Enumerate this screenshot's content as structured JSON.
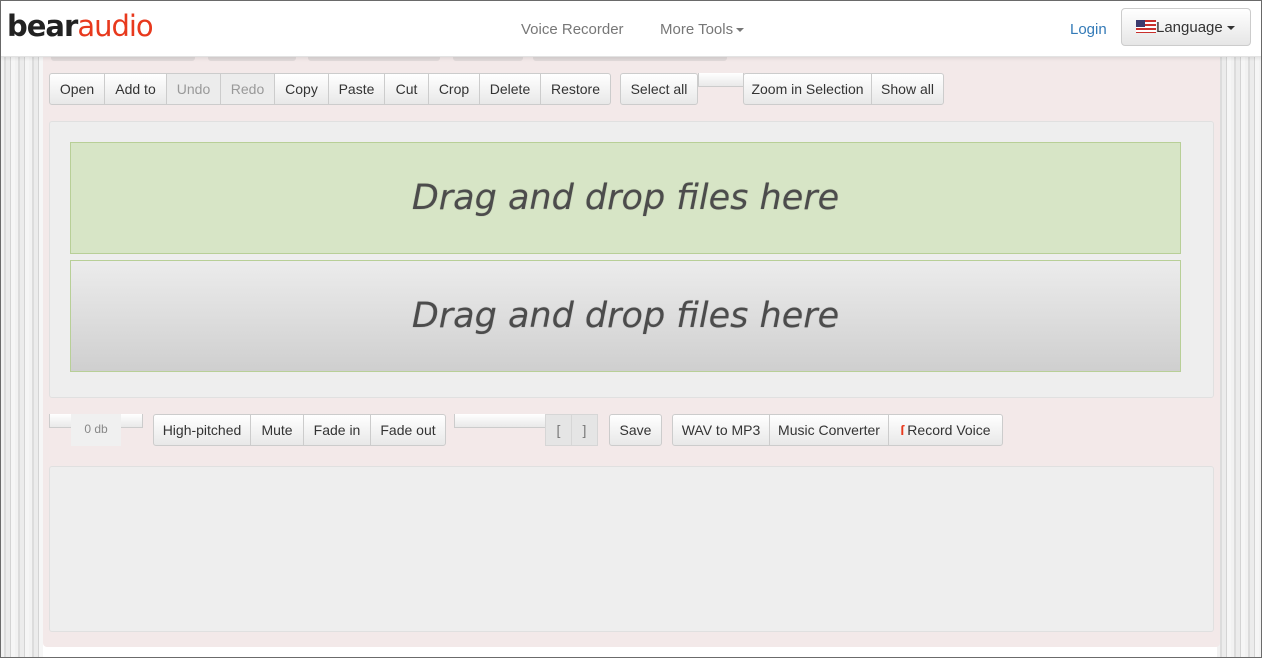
{
  "navbar": {
    "logo_part1": "bear",
    "logo_part2": "audio",
    "voice_recorder": "Voice Recorder",
    "more_tools": "More Tools",
    "login": "Login",
    "language": "Language"
  },
  "toolbar_top": {
    "open": "Open",
    "add_to": "Add to",
    "undo": "Undo",
    "redo": "Redo",
    "copy": "Copy",
    "paste": "Paste",
    "cut": "Cut",
    "crop": "Crop",
    "delete": "Delete",
    "restore": "Restore",
    "select_all": "Select all",
    "zoom_in_selection": "Zoom in Selection",
    "show_all": "Show all"
  },
  "dropzone": {
    "track1": "Drag and drop files here",
    "track2": "Drag and drop files here"
  },
  "toolbar_bottom": {
    "volume": "0 db",
    "high_pitched": "High-pitched",
    "mute": "Mute",
    "fade_in": "Fade in",
    "fade_out": "Fade out",
    "bracket_open": "[",
    "bracket_close": "]",
    "save": "Save",
    "wav_to_mp3": "WAV to MP3",
    "music_converter": "Music Converter",
    "record_voice": "Record Voice"
  },
  "colors": {
    "brand_red": "#e8391d",
    "link_blue": "#337ab7",
    "drop_green": "#d7e5c6"
  }
}
